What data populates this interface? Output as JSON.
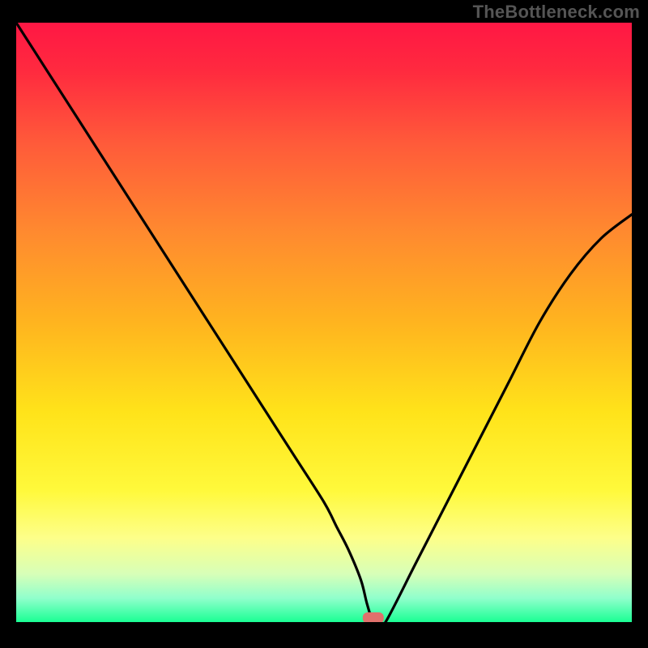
{
  "watermark": "TheBottleneck.com",
  "chart_data": {
    "type": "line",
    "title": "",
    "xlabel": "",
    "ylabel": "",
    "xlim": [
      0,
      100
    ],
    "ylim": [
      0,
      100
    ],
    "background_gradient": {
      "stops": [
        {
          "pos": 0.0,
          "color": "#ff1744"
        },
        {
          "pos": 0.08,
          "color": "#ff2a3f"
        },
        {
          "pos": 0.2,
          "color": "#ff5a3a"
        },
        {
          "pos": 0.35,
          "color": "#ff8a2f"
        },
        {
          "pos": 0.5,
          "color": "#ffb41f"
        },
        {
          "pos": 0.65,
          "color": "#ffe31a"
        },
        {
          "pos": 0.78,
          "color": "#fff93b"
        },
        {
          "pos": 0.86,
          "color": "#fdff8a"
        },
        {
          "pos": 0.92,
          "color": "#d7ffb8"
        },
        {
          "pos": 0.96,
          "color": "#90ffcc"
        },
        {
          "pos": 1.0,
          "color": "#1aff94"
        }
      ]
    },
    "series": [
      {
        "name": "bottleneck-curve",
        "x": [
          0,
          5,
          10,
          15,
          20,
          25,
          30,
          35,
          40,
          45,
          50,
          52,
          54,
          56,
          57,
          58,
          59,
          60,
          65,
          70,
          75,
          80,
          85,
          90,
          95,
          100
        ],
        "y": [
          100,
          92,
          84,
          76,
          68,
          60,
          52,
          44,
          36,
          28,
          20,
          16,
          12,
          7,
          3,
          0,
          0,
          0,
          10,
          20,
          30,
          40,
          50,
          58,
          64,
          68
        ]
      }
    ],
    "marker": {
      "name": "current-point",
      "x": 58,
      "y": 0,
      "color": "#e0716c"
    }
  }
}
